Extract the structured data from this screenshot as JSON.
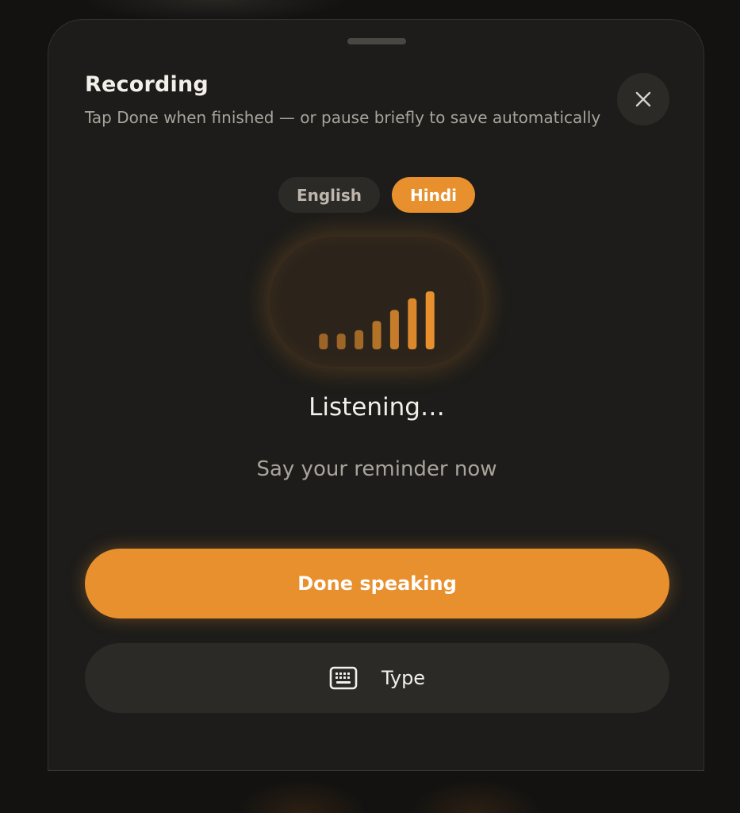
{
  "header": {
    "title": "Recording",
    "subtitle": "Tap Done when finished — or pause briefly to save automatically"
  },
  "close": {
    "icon": "close-icon"
  },
  "languages": [
    {
      "label": "English",
      "selected": false
    },
    {
      "label": "Hindi",
      "selected": true
    }
  ],
  "meter": {
    "icon": "signal-bars-icon",
    "levels": [
      0.27,
      0.27,
      0.33,
      0.49,
      0.68,
      0.88,
      1.0
    ]
  },
  "status": {
    "text": "Listening…",
    "hint": "Say your reminder now"
  },
  "actions": {
    "done_label": "Done speaking",
    "type_label": "Type",
    "type_icon": "keyboard-icon"
  },
  "colors": {
    "accent": "#e8902e",
    "sheet_bg": "#1d1c1a",
    "pill_bg": "#2c2a27"
  }
}
